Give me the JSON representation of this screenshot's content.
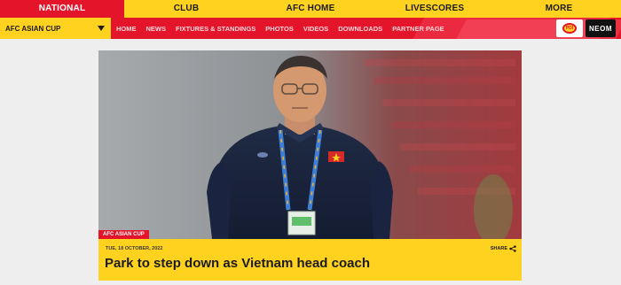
{
  "top_nav": {
    "items": [
      {
        "label": "NATIONAL",
        "active": true
      },
      {
        "label": "CLUB",
        "active": false
      },
      {
        "label": "AFC HOME",
        "active": false
      },
      {
        "label": "LIVESCORES",
        "active": false
      },
      {
        "label": "MORE",
        "active": false
      }
    ]
  },
  "sub_nav": {
    "competition_selector": {
      "label": "AFC ASIAN CUP",
      "icon": "chevron-down-icon"
    },
    "links": [
      "HOME",
      "NEWS",
      "FIXTURES & STANDINGS",
      "PHOTOS",
      "VIDEOS",
      "DOWNLOADS",
      "PARTNER PAGE"
    ],
    "sponsors": [
      "PDI",
      "NEOM"
    ]
  },
  "article": {
    "badge": "AFC ASIAN CUP",
    "date": "TUE, 18 OCTOBER, 2022",
    "share_label": "SHARE",
    "headline": "Park to step down as Vietnam head coach"
  },
  "colors": {
    "brand_yellow": "#ffd21f",
    "brand_red": "#e4152a",
    "page_bg": "#eeeeee"
  }
}
